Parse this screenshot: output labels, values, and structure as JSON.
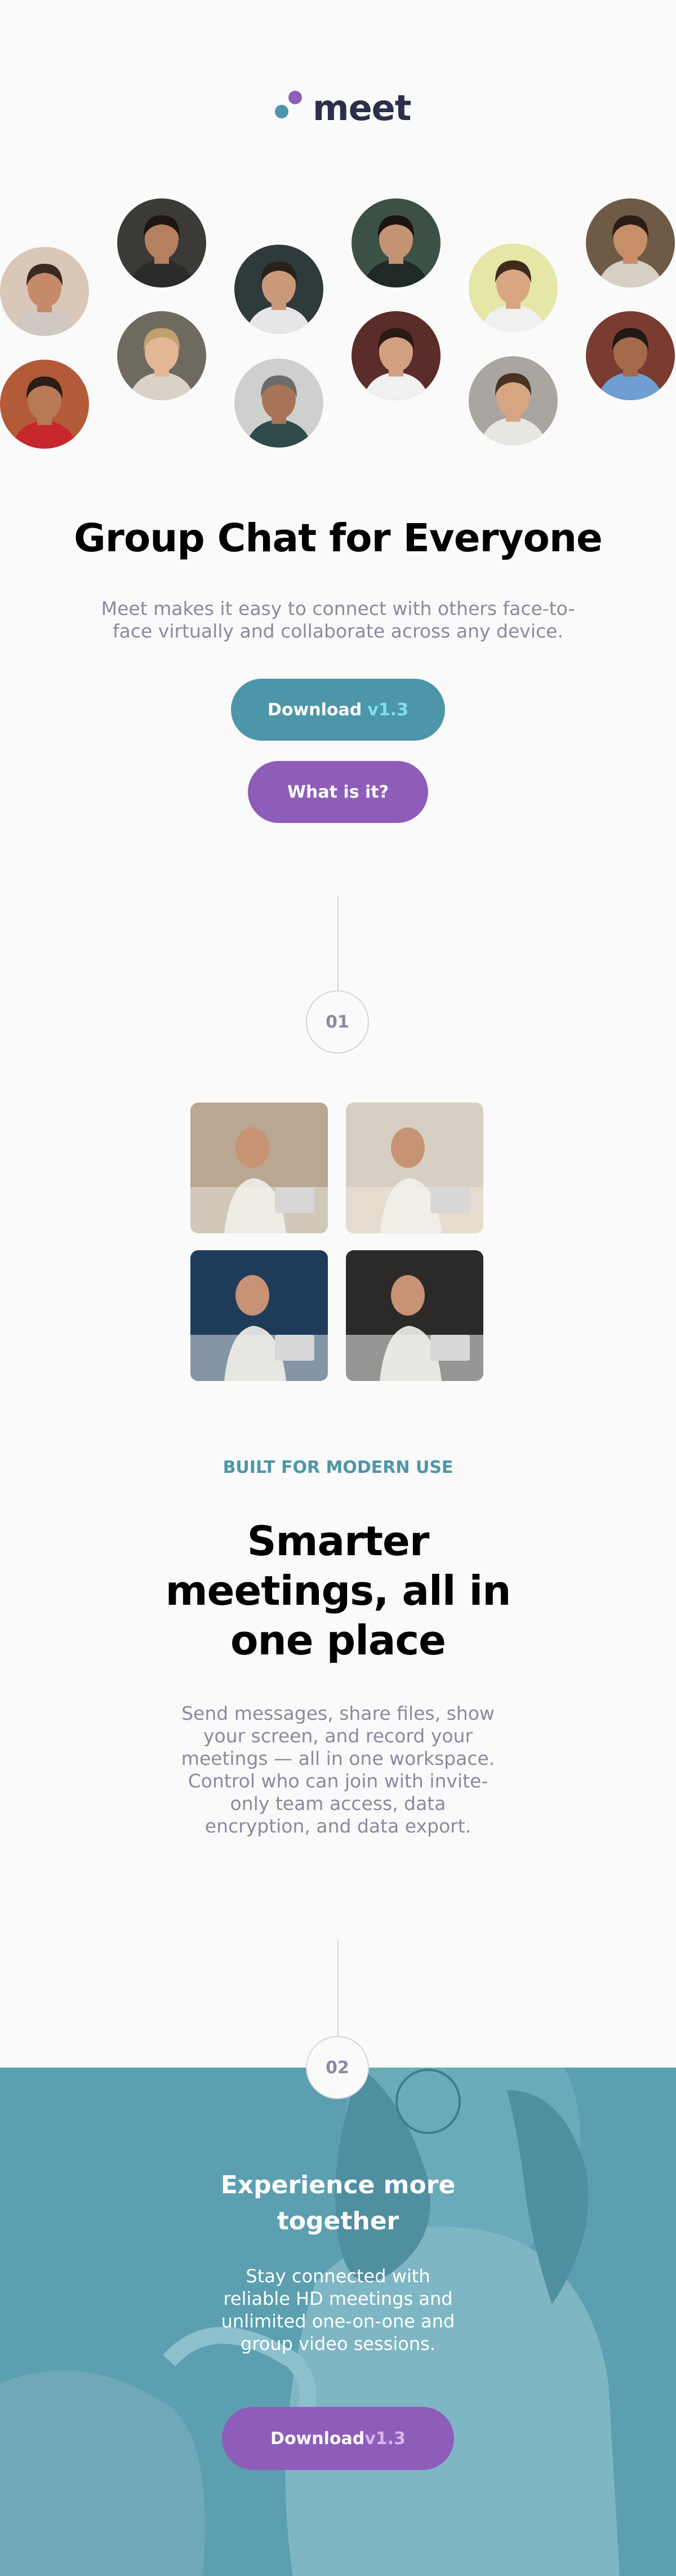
{
  "brand": {
    "name": "meet",
    "dot_colors": [
      "#4d96a9",
      "#8e5dba"
    ]
  },
  "hero": {
    "title": "Group Chat for Everyone",
    "subtitle": "Meet makes it easy to connect with others face-to-face virtually and collaborate across any device.",
    "download_label": "Download",
    "download_version": "v1.3",
    "whatis_label": "What is it?"
  },
  "avatars": [
    {
      "name": "avatar-man-hoodie",
      "bg": "#d9c7b8",
      "skin": "#c48a6a",
      "hair": "#3a2a20",
      "shirt": "#cfc9c2"
    },
    {
      "name": "avatar-man-curly",
      "bg": "#b35a38",
      "skin": "#b77a55",
      "hair": "#2a1d14",
      "shirt": "#c7262c"
    },
    {
      "name": "avatar-woman-dark",
      "bg": "#3b3a36",
      "skin": "#b48060",
      "hair": "#1e1612",
      "shirt": "#2b2b2b"
    },
    {
      "name": "avatar-woman-blonde",
      "bg": "#6f6a60",
      "skin": "#e3b695",
      "hair": "#c2a070",
      "shirt": "#d9d2c6"
    },
    {
      "name": "avatar-man-beard",
      "bg": "#2e3b3a",
      "skin": "#c99a7a",
      "hair": "#2a201a",
      "shirt": "#e6e6e6"
    },
    {
      "name": "avatar-man-older",
      "bg": "#cfd0ce",
      "skin": "#a87356",
      "hair": "#6b6b6b",
      "shirt": "#2e4b4a"
    },
    {
      "name": "avatar-man-sunglasses",
      "bg": "#3c5146",
      "skin": "#c39374",
      "hair": "#1c1512",
      "shirt": "#1f2a26"
    },
    {
      "name": "avatar-man-stubble",
      "bg": "#5a2c2a",
      "skin": "#d0a080",
      "hair": "#2a1a14",
      "shirt": "#f1f1f1"
    },
    {
      "name": "avatar-man-smiling",
      "bg": "#e4e7a6",
      "skin": "#d9a583",
      "hair": "#3d2b1e",
      "shirt": "#f0f0f0"
    },
    {
      "name": "avatar-man-wavy",
      "bg": "#a9a5a0",
      "skin": "#d6a582",
      "hair": "#4a3220",
      "shirt": "#e8e6e2"
    },
    {
      "name": "avatar-couple",
      "bg": "#6e5a45",
      "skin": "#c78e6a",
      "hair": "#2a1d16",
      "shirt": "#d6cfc4"
    },
    {
      "name": "avatar-woman-denim",
      "bg": "#7a3b30",
      "skin": "#a46a4c",
      "hair": "#221814",
      "shirt": "#6e9ed2"
    }
  ],
  "step1": {
    "number": "01"
  },
  "photos": [
    {
      "name": "photo-woman-laptop",
      "bg": "#b9a792",
      "accent": "#e8e3db"
    },
    {
      "name": "photo-women-tablet",
      "bg": "#d8cfc4",
      "accent": "#f0e5d8"
    },
    {
      "name": "photo-video-call",
      "bg": "#1e3c5a",
      "accent": "#d8e0e6"
    },
    {
      "name": "photo-man-phone",
      "bg": "#2c2a28",
      "accent": "#efefef"
    }
  ],
  "features": {
    "eyebrow": "BUILT FOR MODERN USE",
    "title": "Smarter meetings, all in one place",
    "text": "Send messages, share files, show your screen, and record your meetings — all in one workspace. Control who can join with invite-only team access, data encryption, and data export."
  },
  "step2": {
    "number": "02"
  },
  "experience": {
    "title": "Experience more together",
    "text": "Stay connected with reliable HD meetings and unlimited one-on-one and group video sessions.",
    "download_label": "Download",
    "download_version": "v1.3"
  },
  "colors": {
    "teal": "#4d96a9",
    "purple": "#8e5dba",
    "version_accent": "#7fe0ed",
    "teal_section": "#5b9fb0",
    "muted_text": "#8a8aa0"
  }
}
